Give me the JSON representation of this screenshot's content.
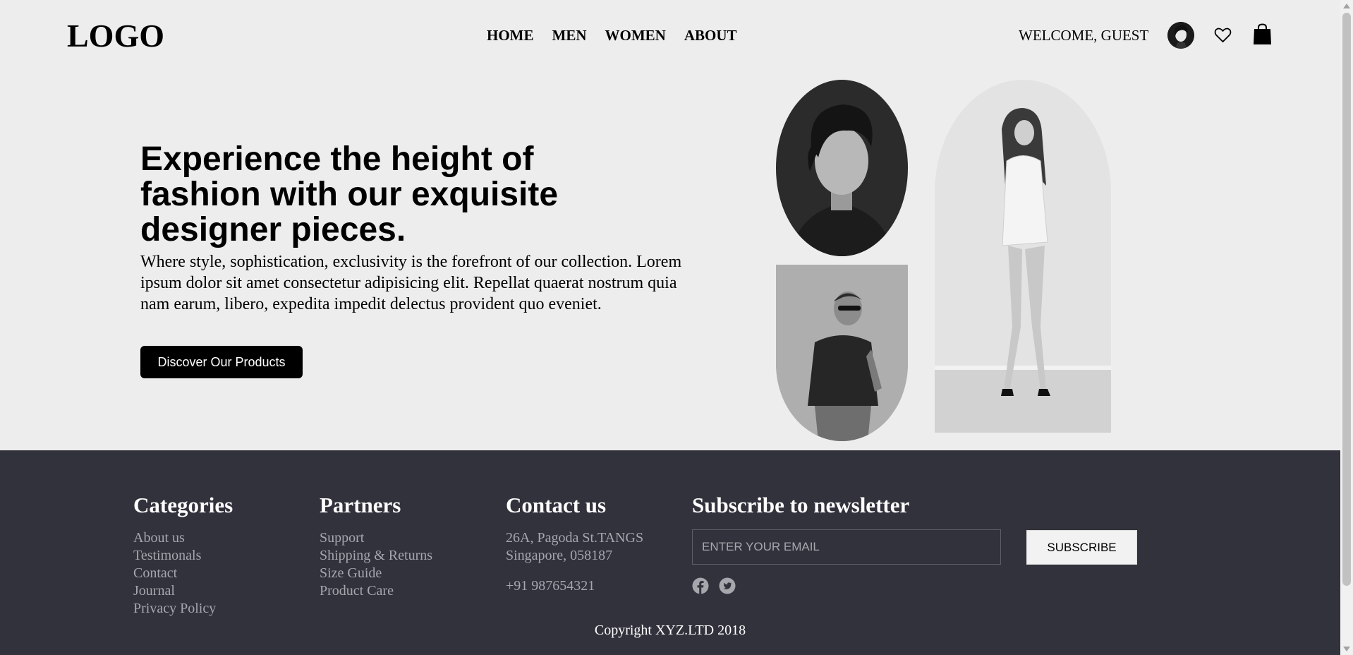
{
  "header": {
    "logo": "LOGO",
    "nav": [
      "HOME",
      "MEN",
      "WOMEN",
      "ABOUT"
    ],
    "welcome": "WELCOME, GUEST",
    "icons": [
      "avatar",
      "heart-icon",
      "shopping-bag-icon"
    ]
  },
  "hero": {
    "title": "Experience the height of fashion with our exquisite designer pieces.",
    "text": "Where style, sophistication, exclusivity is the forefront of our collection. Lorem ipsum dolor sit amet consectetur adipisicing elit. Repellat quaerat nostrum quia nam earum, libero, expedita impedit delectus provident quo eveniet.",
    "cta": "Discover Our Products"
  },
  "footer": {
    "categories": {
      "title": "Categories",
      "items": [
        "About us",
        "Testimonals",
        "Contact",
        "Journal",
        "Privacy Policy"
      ]
    },
    "partners": {
      "title": "Partners",
      "items": [
        "Support",
        "Shipping & Returns",
        "Size Guide",
        "Product Care"
      ]
    },
    "contact": {
      "title": "Contact us",
      "address_line1": "26A, Pagoda St.TANGS",
      "address_line2": "Singapore, 058187",
      "phone": "+91 987654321"
    },
    "newsletter": {
      "title": "Subscribe to newsletter",
      "placeholder": "ENTER YOUR EMAIL",
      "value": "",
      "button": "SUBSCRIBE",
      "social": [
        "facebook-icon",
        "twitter-icon"
      ]
    },
    "copyright": "Copyright XYZ.LTD 2018"
  },
  "colors": {
    "page_bg": "#ededed",
    "footer_bg": "#32323c",
    "footer_link": "#a6a6ad",
    "accent": "#000000"
  }
}
